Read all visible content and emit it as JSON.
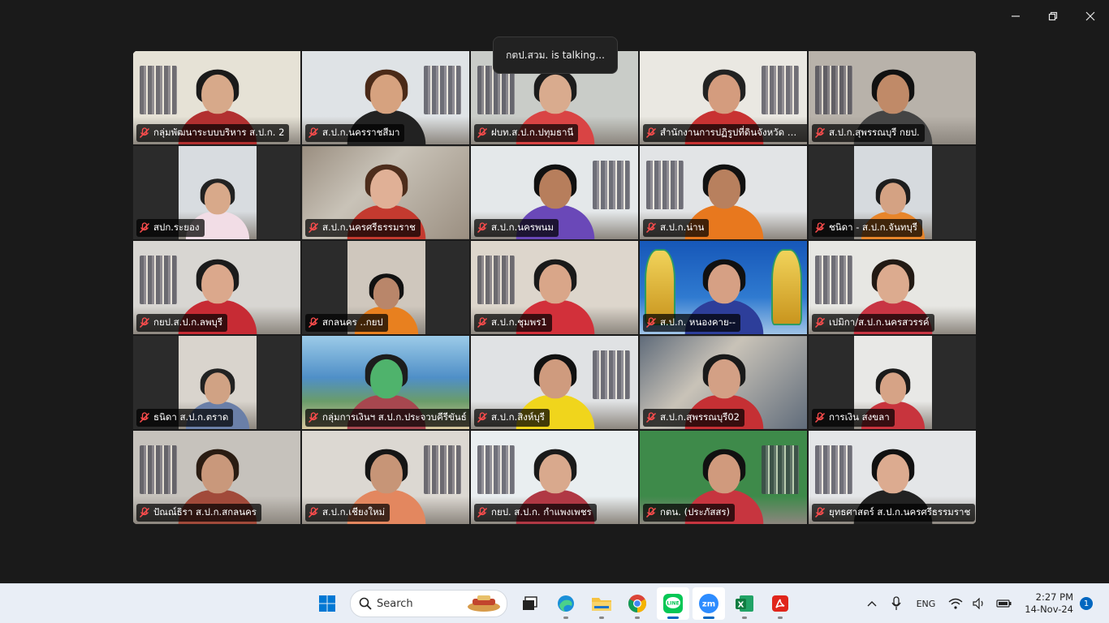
{
  "window": {
    "controls": [
      "minimize",
      "restore",
      "close"
    ]
  },
  "toast": {
    "text": "กตป.สวม. is talking..."
  },
  "participants": [
    {
      "name": "กลุ่มพัฒนาระบบบริหาร ส.ป.ก. 2",
      "scene": "office",
      "skin": "#d7a98a",
      "shirt": "#b23030",
      "hair": "#1a1a1a",
      "wall": "#e6e2d6"
    },
    {
      "name": "ส.ป.ก.นครราชสีมา",
      "scene": "office",
      "skin": "#d6a27f",
      "shirt": "#222",
      "hair": "#4a2a18",
      "wall": "#dfe3e6"
    },
    {
      "name": "ฝบท.ส.ป.ก.ปทุมธานี",
      "scene": "office",
      "skin": "#d9ab8e",
      "shirt": "#d94444",
      "hair": "#1c1c1c",
      "wall": "#c9ccc8"
    },
    {
      "name": "สำนักงานการปฏิรูปที่ดินจังหวัด ลำป...",
      "scene": "office",
      "skin": "#d49c7e",
      "shirt": "#c83232",
      "hair": "#222",
      "wall": "#eae8e2"
    },
    {
      "name": "ส.ป.ก.สุพรรณบุรี กยป.",
      "scene": "office",
      "skin": "#c08a68",
      "shirt": "#444",
      "hair": "#111",
      "wall": "#b8b2aa"
    },
    {
      "name": "สปก.ระยอง",
      "scene": "narrow",
      "skin": "#d8a98a",
      "shirt": "#f2dde6",
      "hair": "#222",
      "wall": "#d8dce0"
    },
    {
      "name": "ส.ป.ก.นครศรีธรรมราช",
      "scene": "blur",
      "skin": "#e0b096",
      "shirt": "#c43a2f",
      "hair": "#4d2d1c",
      "wall": "#9a8e80"
    },
    {
      "name": "ส.ป.ก.นครพนม",
      "scene": "wide",
      "skin": "#b77e5c",
      "shirt": "#6a48b8",
      "hair": "#111",
      "wall": "#e4e8ea"
    },
    {
      "name": "ส.ป.ก.น่าน",
      "scene": "office",
      "skin": "#b8805e",
      "shirt": "#e8781e",
      "hair": "#111",
      "wall": "#e2e4e6"
    },
    {
      "name": "ชนิดา - ส.ป.ก.จันทบุรี",
      "scene": "narrow",
      "skin": "#d4a283",
      "shirt": "#e7852a",
      "hair": "#1d1d1d",
      "wall": "#d6dade"
    },
    {
      "name": "กยป.ส.ป.ก.ลพบุรี",
      "scene": "office",
      "skin": "#dba88c",
      "shirt": "#c72b34",
      "hair": "#1b1b1b",
      "wall": "#d8d6d2"
    },
    {
      "name": "สกลนคร ..กยป",
      "scene": "narrow",
      "skin": "#b9866a",
      "shirt": "#e8801f",
      "hair": "#111",
      "wall": "#cfc7bd"
    },
    {
      "name": "ส.ป.ก.ชุมพร1",
      "scene": "office",
      "skin": "#d9a689",
      "shirt": "#d2303a",
      "hair": "#1a1a1a",
      "wall": "#ddd6cc"
    },
    {
      "name": "ส.ป.ก. หนองคาย--",
      "scene": "naga",
      "skin": "#d6a084",
      "shirt": "#2d3e9a",
      "hair": "#111",
      "wall": "#1b4ea6"
    },
    {
      "name": "เปมิกา/ส.ป.ก.นครสวรรค์",
      "scene": "office",
      "skin": "#dcab8f",
      "shirt": "#c83543",
      "hair": "#221a14",
      "wall": "#e7e7e3"
    },
    {
      "name": "ธนิดา ส.ป.ก.ตราด",
      "scene": "narrow",
      "skin": "#d0a284",
      "shirt": "#6a7fa8",
      "hair": "#222",
      "wall": "#d9d4cd"
    },
    {
      "name": "กลุ่มการเงินฯ ส.ป.ก.ประจวบคีรีขันธ์",
      "scene": "beach",
      "skin": "#4fb36c",
      "shirt": "#a7474f",
      "hair": "#1d1d1d",
      "wall": "#4f8fc7"
    },
    {
      "name": "ส.ป.ก.สิงห์บุรี",
      "scene": "office",
      "skin": "#cf9b7e",
      "shirt": "#f0d51c",
      "hair": "#111",
      "wall": "#e0e2e4"
    },
    {
      "name": "ส.ป.ก.สุพรรณบุรี02",
      "scene": "blur",
      "skin": "#d3a085",
      "shirt": "#c53034",
      "hair": "#1a1a1a",
      "wall": "#5f6b7a"
    },
    {
      "name": "การเงิน สงขลา",
      "scene": "narrow",
      "skin": "#d6a386",
      "shirt": "#c8343d",
      "hair": "#1a1a1a",
      "wall": "#e8e8e6"
    },
    {
      "name": "ปัณณ์ธิรา ส.ป.ก.สกลนคร",
      "scene": "office",
      "skin": "#c9987b",
      "shirt": "#a14a3a",
      "hair": "#2a1c12",
      "wall": "#c6c2bc"
    },
    {
      "name": "ส.ป.ก.เชียงใหม่",
      "scene": "office",
      "skin": "#c79577",
      "shirt": "#e3875f",
      "hair": "#151515",
      "wall": "#dcd8d2"
    },
    {
      "name": "กยป. ส.ป.ก. กำแพงเพชร",
      "scene": "office",
      "skin": "#d9a98d",
      "shirt": "#b03844",
      "hair": "#1a1a1a",
      "wall": "#e9eef0"
    },
    {
      "name": "กตน. (ประภัสสร)",
      "scene": "office",
      "skin": "#d09a7d",
      "shirt": "#c7353f",
      "hair": "#111",
      "wall": "#3e8a4a"
    },
    {
      "name": "ยุทธศาสตร์ ส.ป.ก.นครศรีธรรมราช",
      "scene": "office",
      "skin": "#dcab90",
      "shirt": "#222",
      "hair": "#111",
      "wall": "#e4e6e8"
    }
  ],
  "taskbar": {
    "search_placeholder": "Search",
    "apps": [
      {
        "name": "start",
        "icon": "windows-logo-icon",
        "active": false
      },
      {
        "name": "task-view",
        "icon": "task-view-icon",
        "active": false
      },
      {
        "name": "edge",
        "icon": "edge-icon",
        "active": false
      },
      {
        "name": "file-explorer",
        "icon": "folder-icon",
        "active": false
      },
      {
        "name": "chrome",
        "icon": "chrome-icon",
        "active": false
      },
      {
        "name": "line",
        "icon": "line-icon",
        "active": true
      },
      {
        "name": "zoom",
        "icon": "zoom-icon",
        "active": true
      },
      {
        "name": "excel",
        "icon": "excel-icon",
        "active": false
      },
      {
        "name": "acrobat",
        "icon": "acrobat-icon",
        "active": false
      }
    ],
    "language": "ENG",
    "time": "2:27 PM",
    "date": "14-Nov-24",
    "notification_count": "1"
  }
}
